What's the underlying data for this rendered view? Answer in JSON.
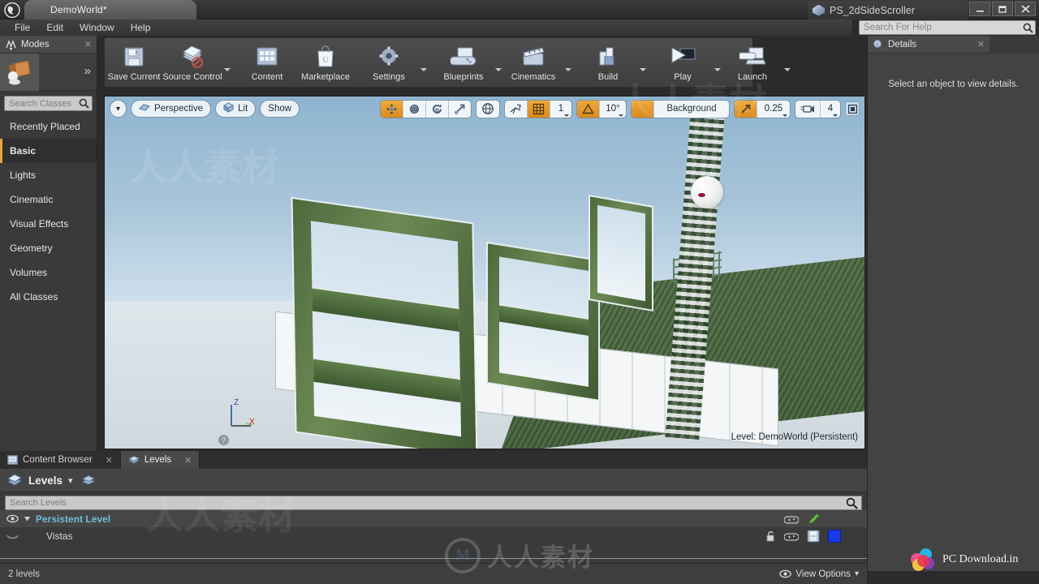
{
  "window": {
    "project_tab": "PS_2dSideScroller",
    "document_tab": "DemoWorld*",
    "minimize_label": "–",
    "restore_label": "❐",
    "close_label": "✕"
  },
  "menu": {
    "items": [
      "File",
      "Edit",
      "Window",
      "Help"
    ]
  },
  "help_search": {
    "placeholder": "Search For Help",
    "value": "",
    "icon": "search-icon"
  },
  "toolbar": {
    "groups": [
      {
        "buttons": [
          {
            "label": "Save Current",
            "icon": "floppy-disk-icon",
            "has_dropdown": false
          },
          {
            "label": "Source Control",
            "icon": "source-control-icon",
            "has_dropdown": true
          }
        ]
      },
      {
        "buttons": [
          {
            "label": "Content",
            "icon": "content-browser-icon",
            "has_dropdown": false
          },
          {
            "label": "Marketplace",
            "icon": "marketplace-bag-icon",
            "has_dropdown": false
          }
        ]
      },
      {
        "buttons": [
          {
            "label": "Settings",
            "icon": "settings-gear-icon",
            "has_dropdown": true
          }
        ]
      },
      {
        "buttons": [
          {
            "label": "Blueprints",
            "icon": "blueprints-gamepad-icon",
            "has_dropdown": true
          },
          {
            "label": "Cinematics",
            "icon": "cinematics-clapper-icon",
            "has_dropdown": true
          }
        ]
      },
      {
        "buttons": [
          {
            "label": "Build",
            "icon": "build-blocks-icon",
            "has_dropdown": true
          }
        ]
      },
      {
        "buttons": [
          {
            "label": "Play",
            "icon": "play-triangle-icon",
            "has_dropdown": true
          },
          {
            "label": "Launch",
            "icon": "launch-device-icon",
            "has_dropdown": true
          }
        ]
      }
    ]
  },
  "modes_panel": {
    "tab_label": "Modes",
    "tab_close": "✕",
    "active_mode_icon": "place-mode-cube-icon",
    "expand_icon": "double-chevron-right-icon",
    "search": {
      "placeholder": "Search Classes",
      "value": ""
    },
    "categories": [
      {
        "label": "Recently Placed",
        "selected": false
      },
      {
        "label": "Basic",
        "selected": true
      },
      {
        "label": "Lights",
        "selected": false
      },
      {
        "label": "Cinematic",
        "selected": false
      },
      {
        "label": "Visual Effects",
        "selected": false
      },
      {
        "label": "Geometry",
        "selected": false
      },
      {
        "label": "Volumes",
        "selected": false
      },
      {
        "label": "All Classes",
        "selected": false
      }
    ]
  },
  "viewport": {
    "menu_caret": "▾",
    "view_mode": "Perspective",
    "lighting_mode": "Lit",
    "show_menu": "Show",
    "transform_tools": [
      {
        "name": "select-move-tool",
        "active": true
      },
      {
        "name": "rotate-2d-tool",
        "active": false
      },
      {
        "name": "rotate-tool",
        "active": false
      },
      {
        "name": "scale-tool",
        "active": false
      }
    ],
    "coordinate_system": "world-globe-icon",
    "surface_snap_icon": "surface-snapping-icon",
    "grid_snap_enabled": true,
    "grid_snap_value": "1",
    "angle_snap_icon": "angle-snap-icon",
    "angle_snap_value": "10°",
    "scale_snap_icon": "scale-snap-icon",
    "scale_snap_value": "0.25",
    "camera_speed_icon": "camera-speed-icon",
    "camera_speed_value": "4",
    "layout_icon": "viewport-layout-icon",
    "background_label": "Background",
    "background_icon": "background-toggle-icon",
    "level_label": "Level:  DemoWorld (Persistent)",
    "axis_z": "Z",
    "axis_x": "X",
    "help_badge": "?"
  },
  "details_panel": {
    "tab_label": "Details",
    "tab_close": "✕",
    "tab_icon": "details-info-icon",
    "empty_message": "Select an object to view details."
  },
  "bottom_panel": {
    "tabs": [
      {
        "label": "Content Browser",
        "icon": "content-browser-icon",
        "active": false,
        "close": "✕"
      },
      {
        "label": "Levels",
        "icon": "levels-stack-icon",
        "active": true,
        "close": "✕"
      }
    ],
    "header_title": "Levels",
    "header_caret": "▾",
    "header_icon": "levels-stack-icon",
    "header_extra_icon": "levels-small-icon",
    "search": {
      "placeholder": "Search Levels",
      "value": "",
      "icon": "search-icon"
    },
    "rows": [
      {
        "name": "Persistent Level",
        "indent": 0,
        "visibility_icon": "eye-open-icon",
        "expander_icon": "triangle-down-icon",
        "color": "#6fbcd8",
        "right_icons": [
          "gamepad-icon",
          "pencil-icon"
        ]
      },
      {
        "name": "Vistas",
        "indent": 1,
        "visibility_icon": "eye-closed-icon",
        "expander_icon": "",
        "color": "#d6d6d6",
        "right_icons": [
          "lock-open-icon",
          "gamepad-icon",
          "save-icon",
          "color-swatch"
        ]
      }
    ],
    "status_text": "2 levels",
    "view_options_label": "View Options",
    "view_options_icon": "eye-open-icon",
    "view_options_caret": "▾",
    "swatch_color": "#1a37e8"
  },
  "watermarks": {
    "center_logo_letter": "M",
    "center_text": "人人素材",
    "tiled": [
      "人人素材",
      "人人素材",
      "人人素材"
    ],
    "corner_brand": "PC Download.in",
    "corner_logo": "colored-circles-logo"
  },
  "colors": {
    "accent_orange": "#e8a33d",
    "panel_bg": "#3a3a3a",
    "toolbar_bg": "#4e4e4e",
    "level_cyan": "#6fbcd8",
    "swatch_blue": "#1a37e8"
  }
}
